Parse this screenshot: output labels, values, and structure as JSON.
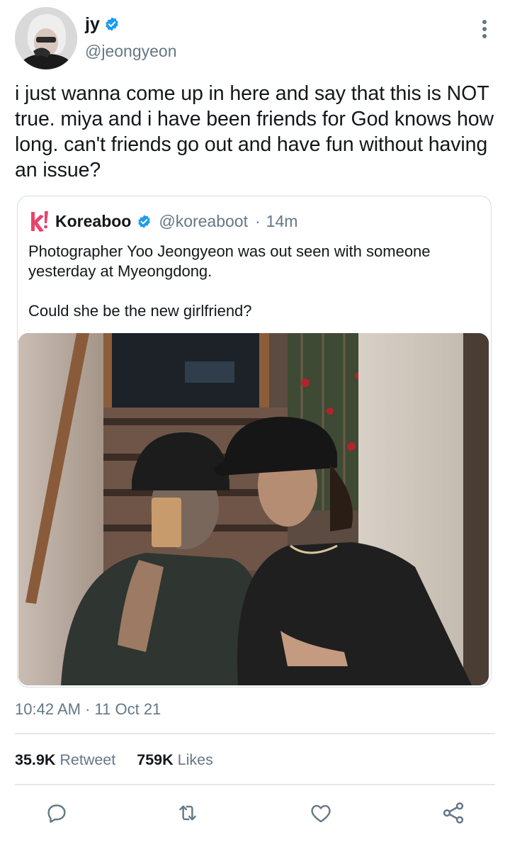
{
  "author": {
    "name": "jy",
    "handle": "@jeongyeon",
    "verified": true
  },
  "tweet": {
    "text": "i just wanna come up in here and say that this is NOT true. miya and i have been friends for God knows how long. can't friends go out and have fun without having an issue?",
    "time": "10:42 AM",
    "date": "11 Oct 21"
  },
  "quote": {
    "name": "Koreaboo",
    "handle": "@koreaboot",
    "separator": "·",
    "age": "14m",
    "logo_text": "k!",
    "text_line1": "Photographer Yoo Jeongyeon was out seen with someone yesterday at Myeongdong.",
    "text_line2": "Could she be the new girlfriend?"
  },
  "stats": {
    "retweets": "35.9K",
    "retweet_label": "Retweet",
    "likes": "759K",
    "likes_label": "Likes"
  },
  "colors": {
    "verified": "#1d9bf0",
    "muted": "#657786",
    "logo": "#e8436b"
  }
}
